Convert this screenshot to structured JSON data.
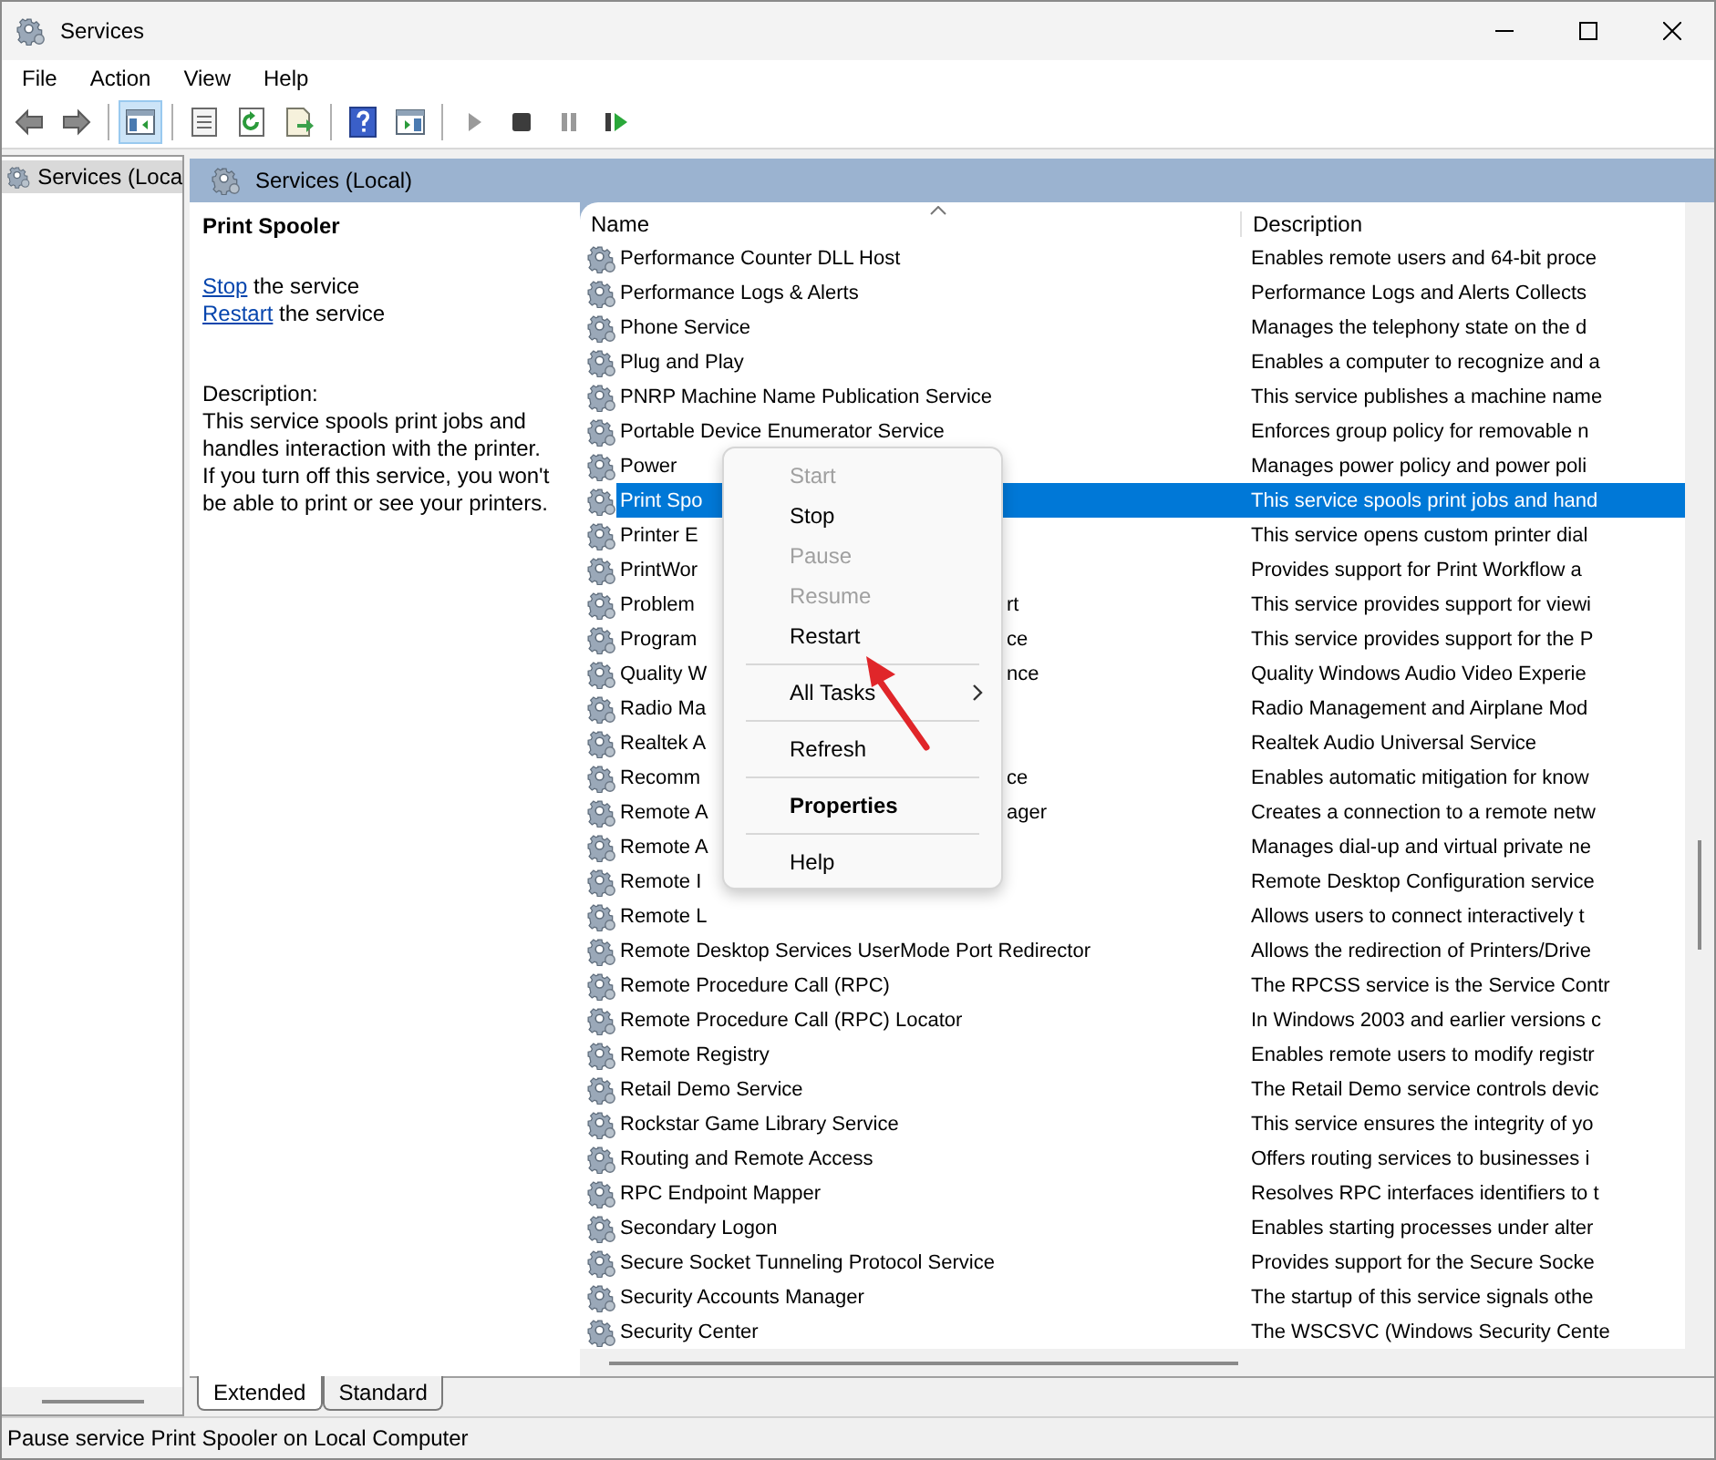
{
  "window": {
    "title": "Services"
  },
  "menu_bar": [
    "File",
    "Action",
    "View",
    "Help"
  ],
  "toolbar": [
    {
      "kind": "back",
      "selected": false
    },
    {
      "kind": "forward",
      "selected": false
    },
    {
      "kind": "separator"
    },
    {
      "kind": "tree",
      "selected": true
    },
    {
      "kind": "separator"
    },
    {
      "kind": "properties",
      "selected": false
    },
    {
      "kind": "refresh",
      "selected": false
    },
    {
      "kind": "export",
      "selected": false
    },
    {
      "kind": "separator"
    },
    {
      "kind": "help",
      "selected": false
    },
    {
      "kind": "action-pane",
      "selected": false
    },
    {
      "kind": "separator"
    },
    {
      "kind": "start",
      "selected": false,
      "disabled": true
    },
    {
      "kind": "stop",
      "selected": false,
      "disabled": false
    },
    {
      "kind": "pause",
      "selected": false,
      "disabled": true
    },
    {
      "kind": "restart",
      "selected": false,
      "disabled": false
    }
  ],
  "tree": {
    "items": [
      {
        "label": "Services (Loca",
        "selected": true
      }
    ]
  },
  "header": {
    "title": "Services (Local)"
  },
  "details": {
    "title": "Print Spooler",
    "actions": [
      {
        "link": "Stop",
        "text": "the service"
      },
      {
        "link": "Restart",
        "text": "the service"
      }
    ],
    "description_label": "Description:",
    "description": "This service spools print jobs and handles interaction with the printer. If you turn off this service, you won't be able to print or see your printers."
  },
  "columns": [
    "Name",
    "Description"
  ],
  "rows": [
    {
      "name": "Performance Counter DLL Host",
      "description": "Enables remote users and 64-bit proce",
      "selected": false
    },
    {
      "name": "Performance Logs & Alerts",
      "description": "Performance Logs and Alerts Collects",
      "selected": false
    },
    {
      "name": "Phone Service",
      "description": "Manages the telephony state on the d",
      "selected": false
    },
    {
      "name": "Plug and Play",
      "description": "Enables a computer to recognize and a",
      "selected": false
    },
    {
      "name": "PNRP Machine Name Publication Service",
      "description": "This service publishes a machine name",
      "selected": false
    },
    {
      "name": "Portable Device Enumerator Service",
      "description": "Enforces group policy for removable n",
      "selected": false
    },
    {
      "name": "Power",
      "description": "Manages power policy and power poli",
      "selected": false
    },
    {
      "name": "Print Spo",
      "description": "This service spools print jobs and hand",
      "selected": true
    },
    {
      "name": "Printer E",
      "description": "This service opens custom printer dial",
      "selected": false
    },
    {
      "name": "PrintWor",
      "description": "Provides support for Print Workflow a",
      "selected": false
    },
    {
      "name": "Problem",
      "tail": "rt",
      "description": "This service provides support for viewi",
      "selected": false
    },
    {
      "name": "Program",
      "tail": "ce",
      "description": "This service provides support for the P",
      "selected": false
    },
    {
      "name": "Quality W",
      "tail": "nce",
      "description": "Quality Windows Audio Video Experie",
      "selected": false
    },
    {
      "name": "Radio Ma",
      "description": "Radio Management and Airplane Mod",
      "selected": false
    },
    {
      "name": "Realtek A",
      "description": "Realtek Audio Universal Service",
      "selected": false
    },
    {
      "name": "Recomm",
      "tail": "ce",
      "description": "Enables automatic mitigation for know",
      "selected": false
    },
    {
      "name": "Remote A",
      "tail": "ager",
      "description": "Creates a connection to a remote netw",
      "selected": false
    },
    {
      "name": "Remote A",
      "description": "Manages dial-up and virtual private ne",
      "selected": false
    },
    {
      "name": "Remote I",
      "description": "Remote Desktop Configuration service",
      "selected": false
    },
    {
      "name": "Remote L",
      "description": "Allows users to connect interactively t",
      "selected": false
    },
    {
      "name": "Remote Desktop Services UserMode Port Redirector",
      "description": "Allows the redirection of Printers/Drive",
      "selected": false
    },
    {
      "name": "Remote Procedure Call (RPC)",
      "description": "The RPCSS service is the Service Contr",
      "selected": false
    },
    {
      "name": "Remote Procedure Call (RPC) Locator",
      "description": "In Windows 2003 and earlier versions c",
      "selected": false
    },
    {
      "name": "Remote Registry",
      "description": "Enables remote users to modify registr",
      "selected": false
    },
    {
      "name": "Retail Demo Service",
      "description": "The Retail Demo service controls devic",
      "selected": false
    },
    {
      "name": "Rockstar Game Library Service",
      "description": "This service ensures the integrity of yo",
      "selected": false
    },
    {
      "name": "Routing and Remote Access",
      "description": "Offers routing services to businesses i",
      "selected": false
    },
    {
      "name": "RPC Endpoint Mapper",
      "description": "Resolves RPC interfaces identifiers to t",
      "selected": false
    },
    {
      "name": "Secondary Logon",
      "description": "Enables starting processes under alter",
      "selected": false
    },
    {
      "name": "Secure Socket Tunneling Protocol Service",
      "description": "Provides support for the Secure Socke",
      "selected": false
    },
    {
      "name": "Security Accounts Manager",
      "description": "The startup of this service signals othe",
      "selected": false
    },
    {
      "name": "Security Center",
      "description": "The WSCSVC (Windows Security Cente",
      "selected": false
    }
  ],
  "context_menu": {
    "items": [
      {
        "kind": "item",
        "label": "Start",
        "disabled": true,
        "default": false
      },
      {
        "kind": "item",
        "label": "Stop",
        "disabled": false,
        "default": false
      },
      {
        "kind": "item",
        "label": "Pause",
        "disabled": true,
        "default": false
      },
      {
        "kind": "item",
        "label": "Resume",
        "disabled": true,
        "default": false
      },
      {
        "kind": "item",
        "label": "Restart",
        "disabled": false,
        "default": false
      },
      {
        "kind": "separator"
      },
      {
        "kind": "submenu",
        "label": "All Tasks",
        "disabled": false,
        "default": false
      },
      {
        "kind": "separator"
      },
      {
        "kind": "item",
        "label": "Refresh",
        "disabled": false,
        "default": false
      },
      {
        "kind": "separator"
      },
      {
        "kind": "item",
        "label": "Properties",
        "disabled": false,
        "default": true
      },
      {
        "kind": "separator"
      },
      {
        "kind": "item",
        "label": "Help",
        "disabled": false,
        "default": false
      }
    ]
  },
  "view_tabs": [
    {
      "label": "Extended",
      "selected": true
    },
    {
      "label": "Standard",
      "selected": false
    }
  ],
  "status_bar": "Pause service Print Spooler on Local Computer"
}
